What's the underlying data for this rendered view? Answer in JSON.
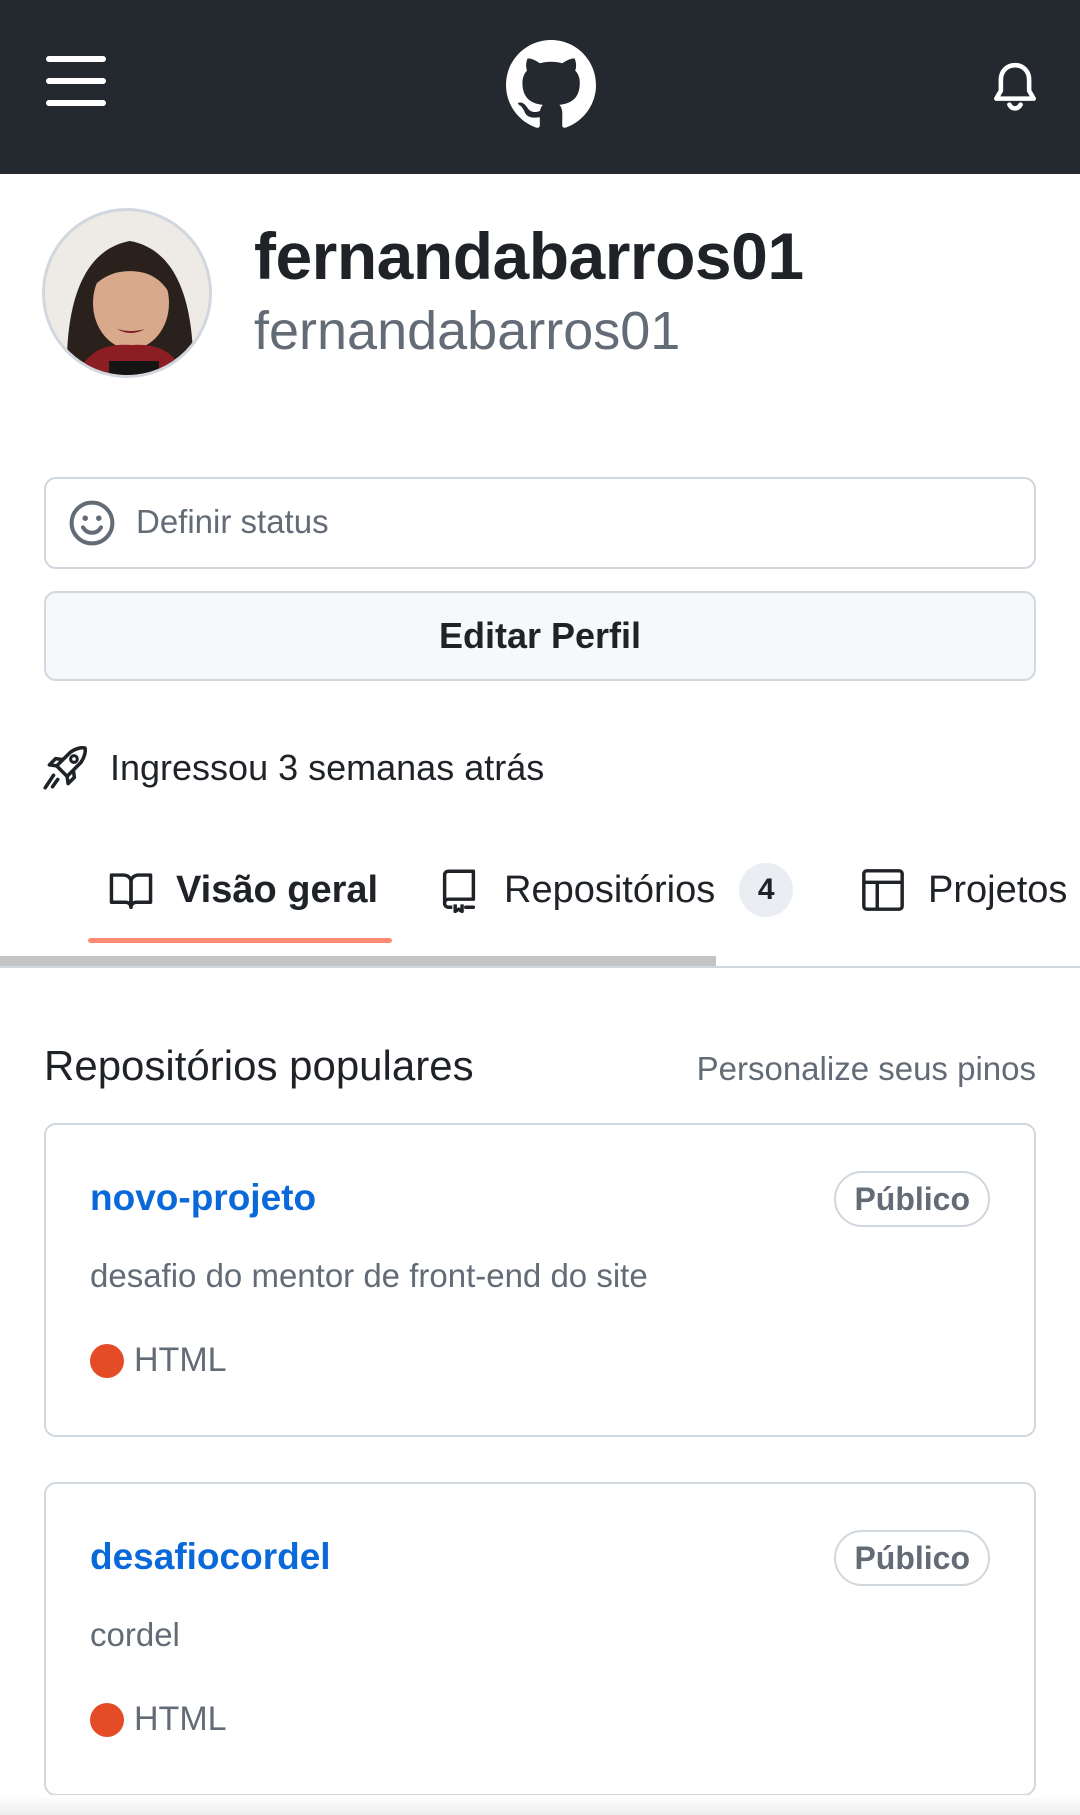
{
  "header": {
    "menu_icon": "hamburger-menu-icon",
    "logo_icon": "github-octocat-icon",
    "notification_icon": "bell-icon",
    "background": "#24292f"
  },
  "profile": {
    "display_name": "fernandabarros01",
    "login": "fernandabarros01",
    "status_icon": "smiley-icon",
    "status_placeholder": "Definir status",
    "edit_profile_label": "Editar Perfil",
    "joined_icon": "rocket-icon",
    "joined_text": "Ingressou 3 semanas atrás"
  },
  "tabs": [
    {
      "label": "Visão geral",
      "icon": "book-icon",
      "active": true
    },
    {
      "label": "Repositórios",
      "icon": "repo-icon",
      "count": "4",
      "active": false
    },
    {
      "label": "Projetos",
      "icon": "table-icon",
      "active": false
    }
  ],
  "popular": {
    "title": "Repositórios populares",
    "customize_link": "Personalize seus pinos"
  },
  "repositories": [
    {
      "name": "novo-projeto",
      "visibility": "Público",
      "description": "desafio do mentor de front-end do site",
      "language": "HTML",
      "language_color": "#e34c26"
    },
    {
      "name": "desafiocordel",
      "visibility": "Público",
      "description": "cordel",
      "language": "HTML",
      "language_color": "#e34c26"
    }
  ],
  "colors": {
    "link": "#0969da",
    "tab_underline": "#fd8c73",
    "muted_text": "#636c76",
    "border": "#d0d7de"
  }
}
